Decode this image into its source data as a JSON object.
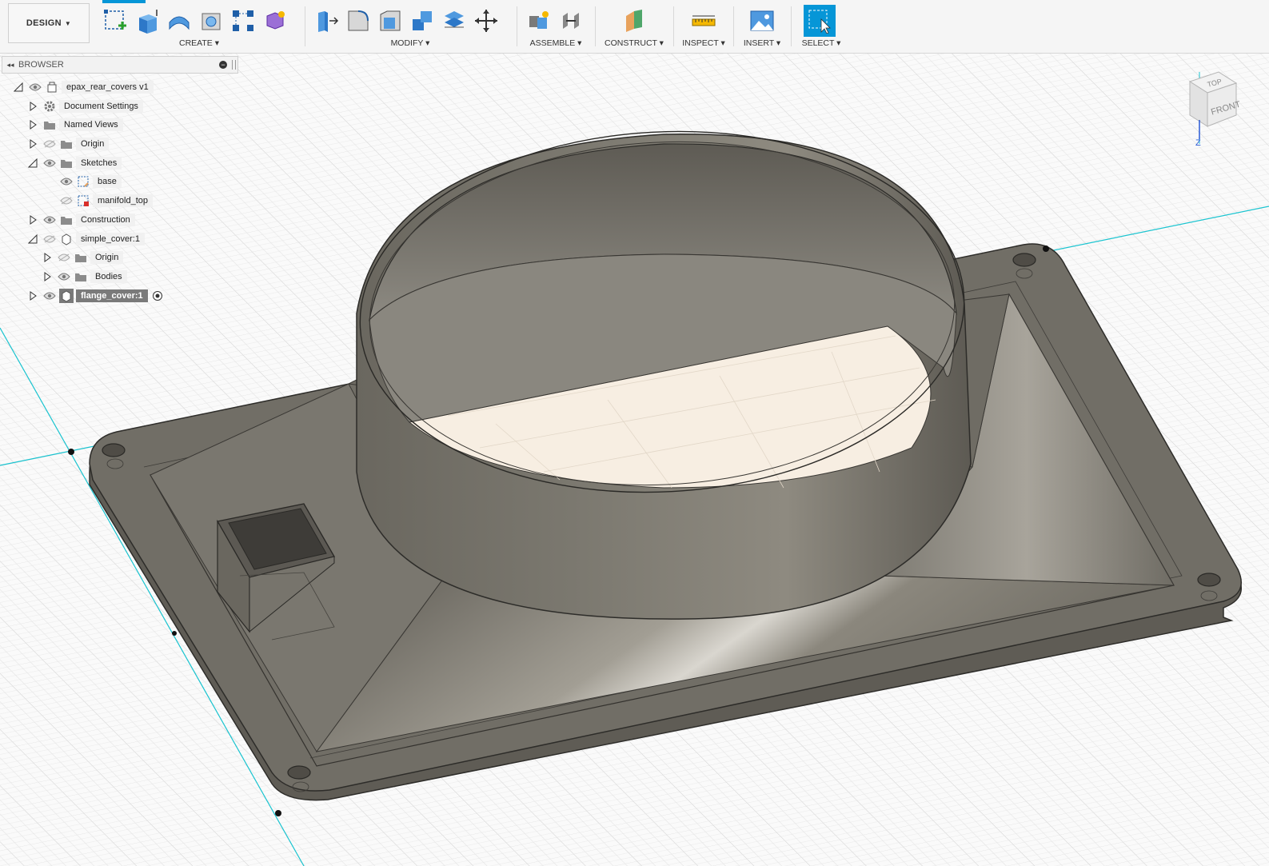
{
  "toolbar": {
    "workspace_label": "DESIGN",
    "groups": [
      {
        "label": "CREATE"
      },
      {
        "label": "MODIFY"
      },
      {
        "label": "ASSEMBLE"
      },
      {
        "label": "CONSTRUCT"
      },
      {
        "label": "INSPECT"
      },
      {
        "label": "INSERT"
      },
      {
        "label": "SELECT"
      }
    ]
  },
  "browser": {
    "title": "BROWSER",
    "items": [
      {
        "label": "epax_rear_covers v1"
      },
      {
        "label": "Document Settings"
      },
      {
        "label": "Named Views"
      },
      {
        "label": "Origin"
      },
      {
        "label": "Sketches"
      },
      {
        "label": "base"
      },
      {
        "label": "manifold_top"
      },
      {
        "label": "Construction"
      },
      {
        "label": "simple_cover:1"
      },
      {
        "label": "Origin"
      },
      {
        "label": "Bodies"
      },
      {
        "label": "flange_cover:1"
      }
    ]
  },
  "viewcube": {
    "top_label": "TOP",
    "front_label": "FRONT",
    "axis_label": "Z"
  },
  "colors": {
    "accent": "#0696d7",
    "body": "#6e6b63",
    "axis": "#19c3cf"
  }
}
